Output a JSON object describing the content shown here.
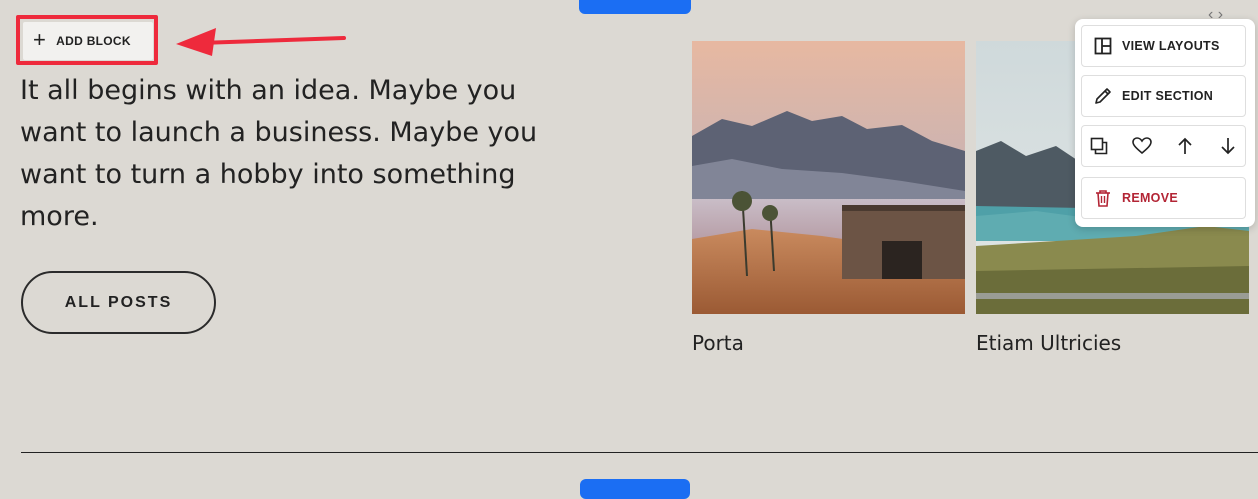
{
  "toolbar": {
    "add_block_label": "ADD BLOCK"
  },
  "intro": {
    "text": "It all begins with an idea. Maybe you want to launch a business. Maybe you want to turn a hobby into something more."
  },
  "buttons": {
    "all_posts_label": "ALL POSTS"
  },
  "posts": [
    {
      "title": "Porta"
    },
    {
      "title": "Etiam Ultricies"
    }
  ],
  "section_menu": {
    "view_layouts": "VIEW LAYOUTS",
    "edit_section": "EDIT SECTION",
    "remove": "REMOVE"
  },
  "colors": {
    "background": "#dcd9d3",
    "accent_blue": "#1b6ef3",
    "highlight_red": "#ee2a3c",
    "remove_red": "#b32535"
  }
}
